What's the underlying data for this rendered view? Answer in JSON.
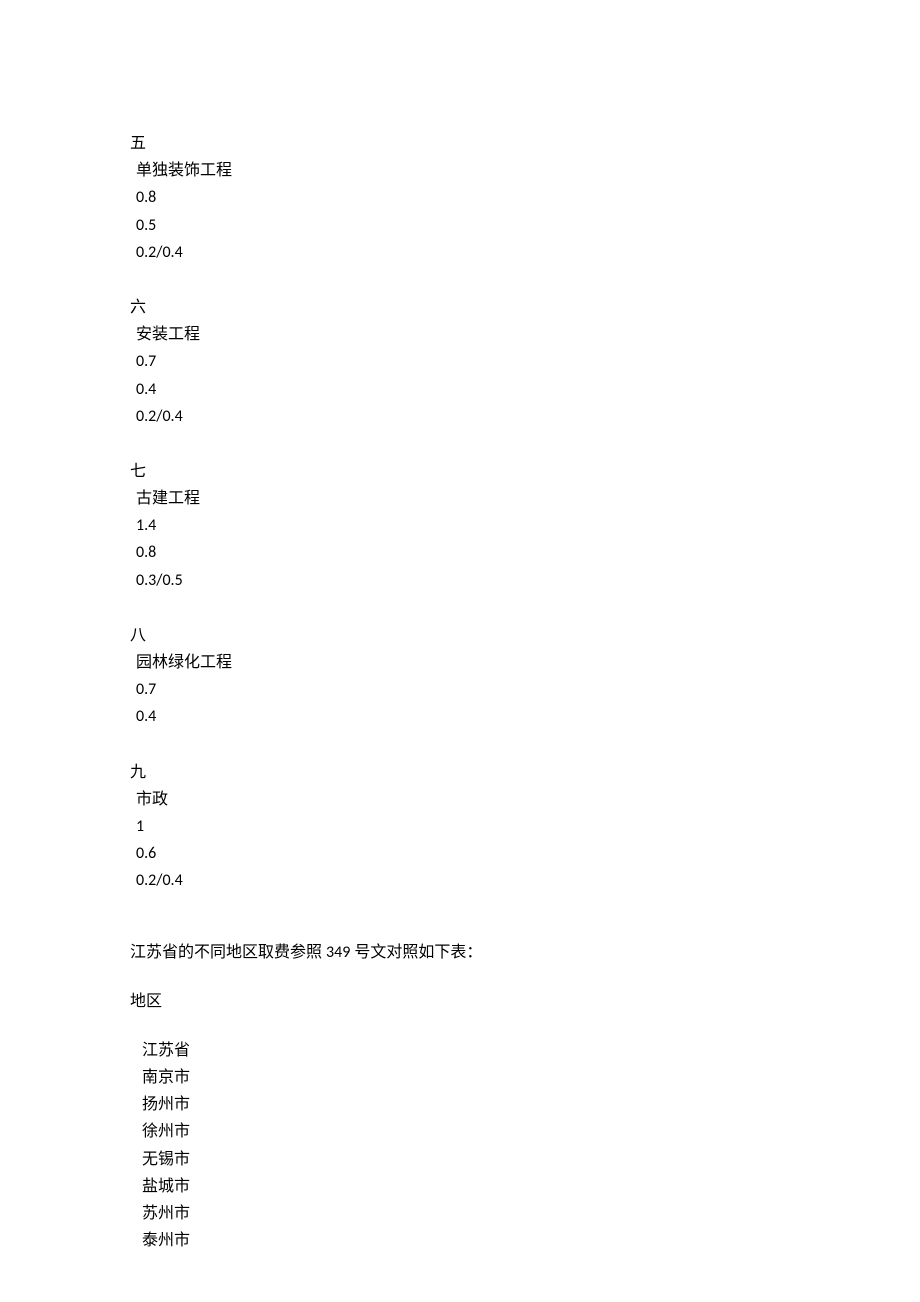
{
  "sections": [
    {
      "header": "五",
      "rows": [
        "单独装饰工程",
        "0.8",
        "0.5",
        "0.2/0.4"
      ]
    },
    {
      "header": "六",
      "rows": [
        "安装工程",
        "0.7",
        "0.4",
        "0.2/0.4"
      ]
    },
    {
      "header": "七",
      "rows": [
        "古建工程",
        "1.4",
        "0.8",
        "0.3/0.5"
      ]
    },
    {
      "header": "八",
      "rows": [
        "园林绿化工程",
        "0.7",
        "0.4",
        ""
      ]
    },
    {
      "header": "九",
      "rows": [
        "市政",
        "1",
        "0.6",
        "0.2/0.4"
      ]
    }
  ],
  "intro_prefix": "江苏省的不同地区取费参照 ",
  "intro_number": "349",
  "intro_suffix": " 号文对照如下表：",
  "region_header": "地区",
  "regions": [
    "江苏省",
    "南京市",
    "扬州市",
    "徐州市",
    "无锡市",
    "盐城市",
    "苏州市",
    "泰州市"
  ]
}
